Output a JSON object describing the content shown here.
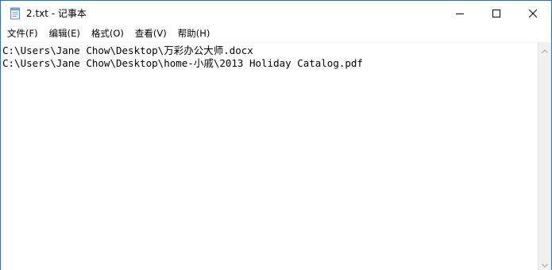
{
  "window": {
    "title": "2.txt - 记事本",
    "icon": "notepad-icon"
  },
  "caption_buttons": {
    "minimize_icon": "minimize-icon",
    "maximize_icon": "maximize-icon",
    "close_icon": "close-icon"
  },
  "menu": {
    "items": [
      {
        "label": "文件(F)"
      },
      {
        "label": "编辑(E)"
      },
      {
        "label": "格式(O)"
      },
      {
        "label": "查看(V)"
      },
      {
        "label": "帮助(H)"
      }
    ]
  },
  "editor": {
    "lines": [
      "C:\\Users\\Jane Chow\\Desktop\\万彩办公大师.docx",
      "C:\\Users\\Jane Chow\\Desktop\\home-小戚\\2013 Holiday Catalog.pdf"
    ]
  },
  "colors": {
    "accent_border": "#1f6fd1",
    "scrollbar_bg": "#f0f0f0"
  }
}
